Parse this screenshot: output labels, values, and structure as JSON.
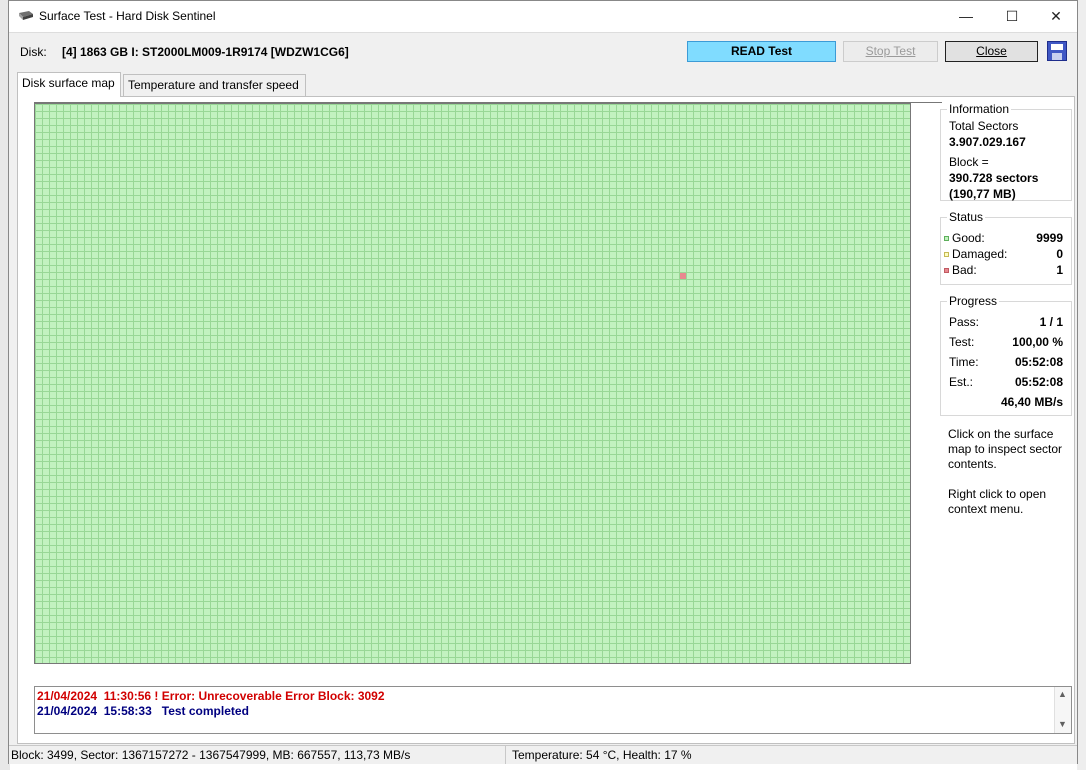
{
  "window": {
    "title": "Surface Test - Hard Disk Sentinel",
    "minimize": "—",
    "maximize": "☐",
    "close": "✕"
  },
  "toolbar": {
    "disk_label": "Disk:",
    "disk_name": "[4] 1863 GB I: ST2000LM009-1R9174 [WDZW1CG6]",
    "read_test_label": "READ Test",
    "stop_test_label": "Stop Test",
    "close_label": "Close"
  },
  "tabs": [
    {
      "label": "Disk surface map",
      "active": true
    },
    {
      "label": "Temperature and transfer speed",
      "active": false
    }
  ],
  "colors": {
    "good": "#c2f2c0",
    "damaged": "#fdfdc0",
    "bad": "#e8888f",
    "read_button": "#80dcff",
    "error_log": "#d10000",
    "info_log": "#000080"
  },
  "surface_map": {
    "bad_blocks": [
      3092
    ]
  },
  "information": {
    "title": "Information",
    "total_sectors_label": "Total Sectors",
    "total_sectors_value": "3.907.029.167",
    "block_label": "Block =",
    "block_sectors": "390.728 sectors",
    "block_size": "(190,77 MB)"
  },
  "status": {
    "title": "Status",
    "good_label": "Good:",
    "good_value": "9999",
    "damaged_label": "Damaged:",
    "damaged_value": "0",
    "bad_label": "Bad:",
    "bad_value": "1"
  },
  "progress": {
    "title": "Progress",
    "pass_label": "Pass:",
    "pass_value": "1 / 1",
    "test_label": "Test:",
    "test_value": "100,00 %",
    "time_label": "Time:",
    "time_value": "05:52:08",
    "est_label": "Est.:",
    "est_value": "05:52:08",
    "speed": "46,40 MB/s"
  },
  "help": {
    "click_text": "Click on the surface map to inspect sector contents.",
    "right_click_text": "Right click to open context menu."
  },
  "log": [
    {
      "text": "21/04/2024  11:30:56 ! Error: Unrecoverable Error Block: 3092",
      "type": "error"
    },
    {
      "text": "21/04/2024  15:58:33   Test completed",
      "type": "info"
    }
  ],
  "statusbar": {
    "left": "Block: 3499, Sector: 1367157272 - 1367547999, MB: 667557, 113,73 MB/s",
    "right": "Temperature: 54  °C,  Health: 17 %"
  }
}
